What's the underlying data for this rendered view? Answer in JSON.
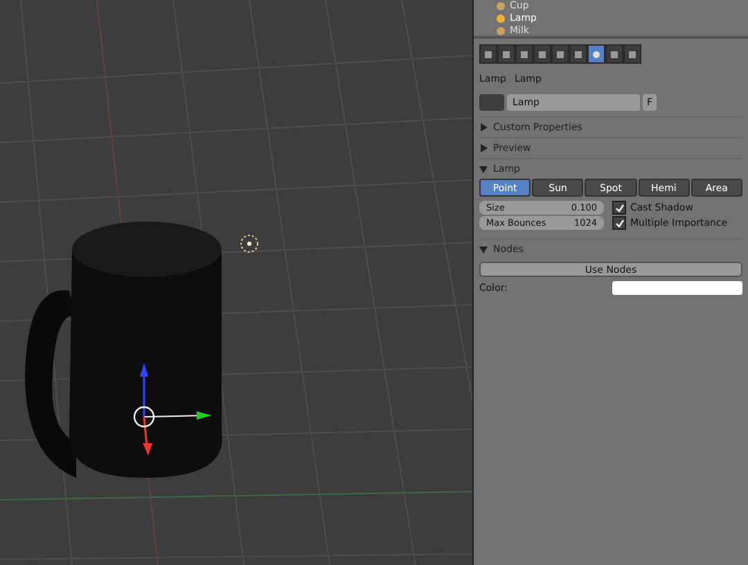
{
  "outliner": {
    "items": [
      {
        "label": "Cup",
        "selected": false
      },
      {
        "label": "Lamp",
        "selected": true
      },
      {
        "label": "Milk",
        "selected": false
      }
    ]
  },
  "context_tabs": [
    {
      "kind": "render",
      "selected": false
    },
    {
      "kind": "layers",
      "selected": false
    },
    {
      "kind": "scene",
      "selected": false
    },
    {
      "kind": "world",
      "selected": false
    },
    {
      "kind": "object",
      "selected": false
    },
    {
      "kind": "constraints",
      "selected": false
    },
    {
      "kind": "data",
      "selected": true
    },
    {
      "kind": "texture",
      "selected": false
    },
    {
      "kind": "particles",
      "selected": false
    }
  ],
  "breadcrumb": [
    "Lamp",
    "Lamp"
  ],
  "datablock": {
    "name": "Lamp",
    "fake_user": "F"
  },
  "custom_properties": {
    "title": "Custom Properties",
    "expanded": false
  },
  "preview": {
    "title": "Preview",
    "expanded": false
  },
  "lamp": {
    "title": "Lamp",
    "expanded": true,
    "types": [
      {
        "label": "Point",
        "selected": true
      },
      {
        "label": "Sun",
        "selected": false
      },
      {
        "label": "Spot",
        "selected": false
      },
      {
        "label": "Hemi",
        "selected": false
      },
      {
        "label": "Area",
        "selected": false
      }
    ],
    "fields": [
      {
        "label": "Size",
        "value": "0.100"
      },
      {
        "label": "Max Bounces",
        "value": "1024"
      }
    ],
    "checkboxes": [
      {
        "label": "Cast Shadow",
        "checked": true
      },
      {
        "label": "Multiple Importance",
        "checked": true
      }
    ]
  },
  "nodes": {
    "title": "Nodes",
    "expanded": true,
    "button": "Use Nodes",
    "color_label": "Color:",
    "color": "#ffffff"
  }
}
